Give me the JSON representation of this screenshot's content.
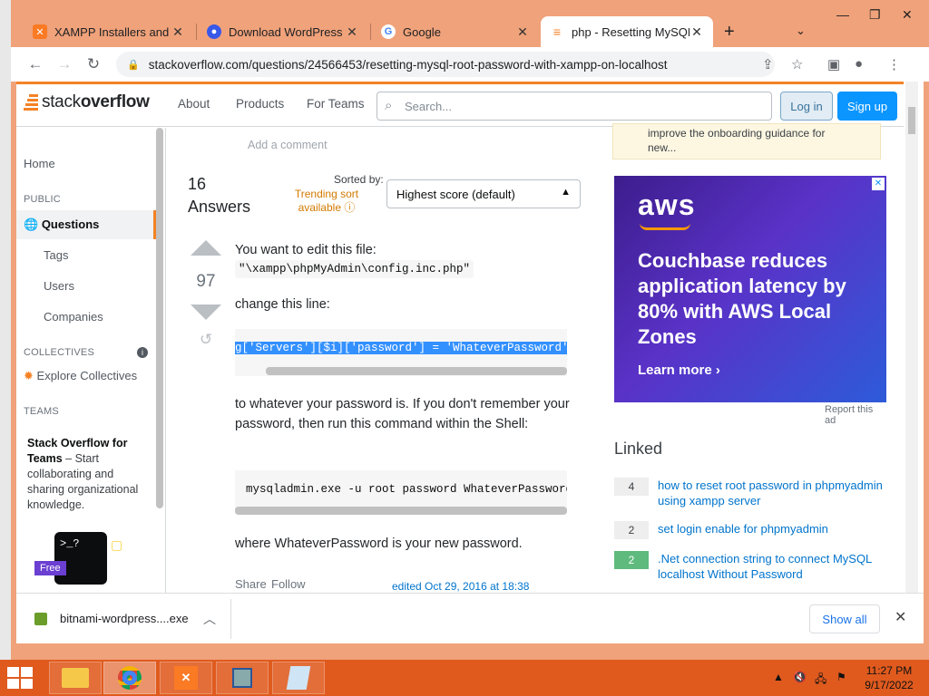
{
  "browser": {
    "tabs": [
      {
        "title": "XAMPP Installers and D",
        "icon": "xampp-icon",
        "color": "#fb7a24"
      },
      {
        "title": "Download WordPress p",
        "icon": "wordpress-shield-icon",
        "color": "#3858e9"
      },
      {
        "title": "Google",
        "icon": "google-icon",
        "color": "#4285f4"
      },
      {
        "title": "php - Resetting MySQL",
        "icon": "stackoverflow-icon",
        "color": "#f48225"
      }
    ],
    "url": "stackoverflow.com/questions/24566453/resetting-mysql-root-password-with-xampp-on-localhost"
  },
  "so": {
    "logo_light": "stack",
    "logo_bold": "overflow",
    "nav": [
      "About",
      "Products",
      "For Teams"
    ],
    "search_placeholder": "Search...",
    "login": "Log in",
    "signup": "Sign up"
  },
  "sidebar": {
    "home": "Home",
    "public": "PUBLIC",
    "questions": "Questions",
    "tags": "Tags",
    "users": "Users",
    "companies": "Companies",
    "collectives": "COLLECTIVES",
    "explore": "Explore Collectives",
    "teams": "TEAMS",
    "teams_title": "Stack Overflow for Teams",
    "teams_desc": " – Start collaborating and sharing organizational knowledge.",
    "free": "Free"
  },
  "main": {
    "add_comment": "Add a comment",
    "answers_num": "16",
    "answers_word": "Answers",
    "sorted_by": "Sorted by:",
    "trending": "Trending sort available",
    "sort_value": "Highest score (default)",
    "votes": "97",
    "p1": "You want to edit this file:",
    "code1": "\"\\xampp\\phpMyAdmin\\config.inc.php\"",
    "p2": "change this line:",
    "code2": "g['Servers'][$i]['password'] = 'WhateverPassword';",
    "p3": "to whatever your password is. If you don't remember your password, then run this command within the Shell:",
    "code3": "mysqladmin.exe -u root password WhateverPassword",
    "p4": "where WhateverPassword is your new password.",
    "share": "Share",
    "follow": "Follow",
    "edited": "edited Oct 29, 2016 at 18:38"
  },
  "right": {
    "notice": "improve the onboarding guidance for new...",
    "ad_brand": "aws",
    "ad_headline": "Couchbase reduces application latency by 80% with AWS Local Zones",
    "ad_cta": "Learn more ›",
    "report": "Report this ad",
    "linked_title": "Linked",
    "linked": [
      {
        "count": "4",
        "text": "how to reset root password in phpmyadmin using xampp server",
        "accepted": false
      },
      {
        "count": "2",
        "text": "set login enable for phpmyadmin",
        "accepted": false
      },
      {
        "count": "2",
        "text": ".Net connection string to connect MySQL localhost Without Password",
        "accepted": true
      }
    ]
  },
  "download": {
    "file": "bitnami-wordpress....exe",
    "show_all": "Show all"
  },
  "taskbar": {
    "time": "11:27 PM",
    "date": "9/17/2022"
  }
}
